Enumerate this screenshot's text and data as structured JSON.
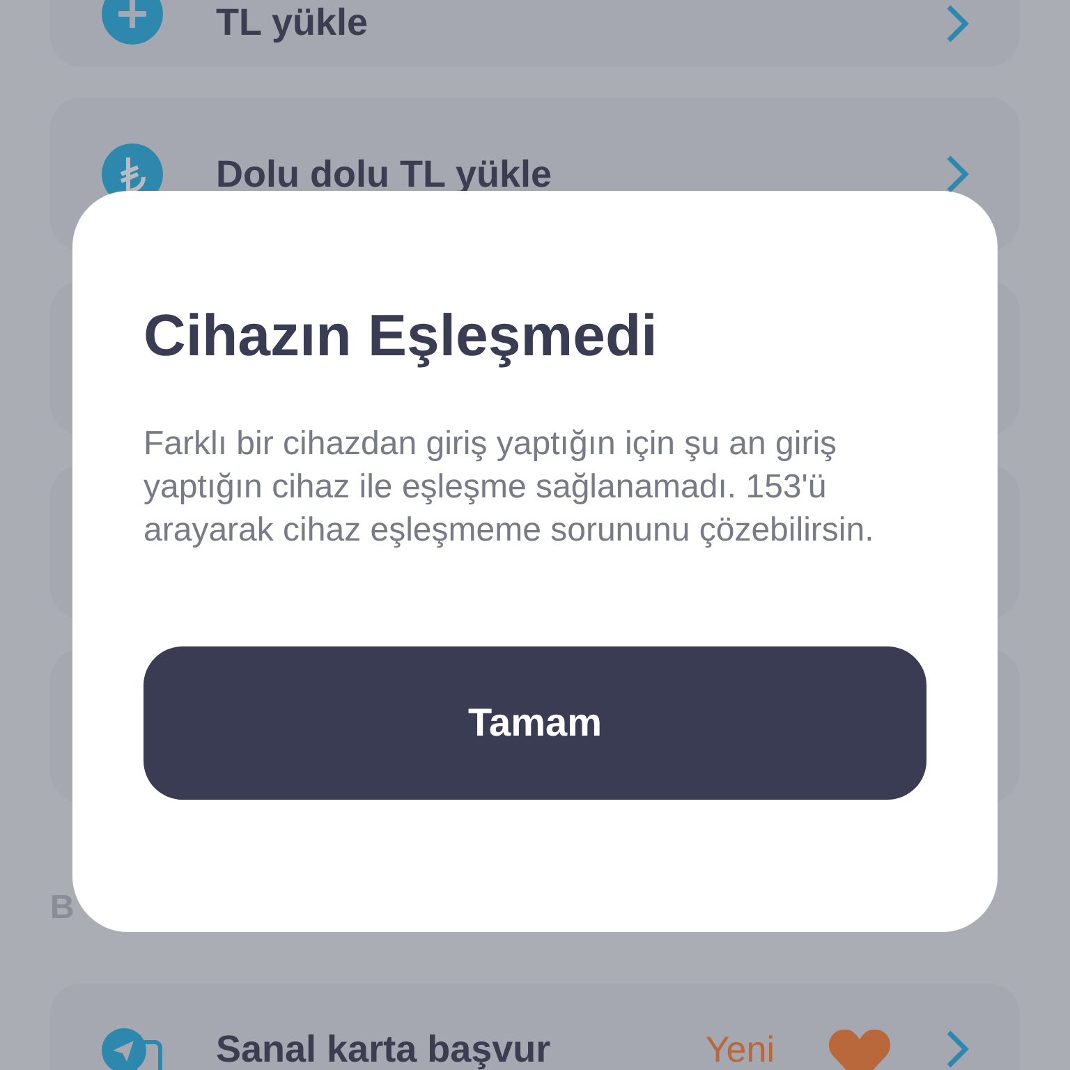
{
  "background_list": {
    "items": [
      {
        "kind": "item",
        "label": "TL yükle"
      },
      {
        "kind": "item",
        "label": "Dolu dolu TL yükle"
      },
      {
        "kind": "blank"
      },
      {
        "kind": "blank"
      },
      {
        "kind": "blank"
      },
      {
        "kind": "header",
        "label": "B"
      },
      {
        "kind": "item",
        "label": "Sanal karta başvur",
        "badge": "Yeni"
      }
    ]
  },
  "dialog": {
    "title": "Cihazın Eşleşmedi",
    "message": "Farklı bir cihazdan giriş yaptığın için şu an giriş yaptığın cihaz ile eşleşme sağlanamadı. 153'ü arayarak cihaz eşleşmeme sorununu çözebilirsin.",
    "button": "Tamam"
  }
}
